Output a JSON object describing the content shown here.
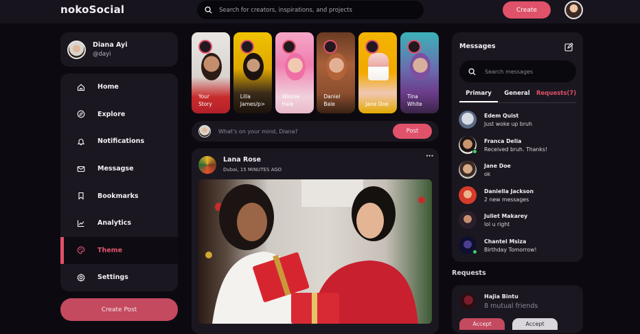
{
  "app": {
    "logo": "nokoSocial"
  },
  "topbar": {
    "search_placeholder": "Search for creators, inspirations, and projects",
    "create_label": "Create"
  },
  "profile": {
    "name": "Diana Ayi",
    "handle": "@dayi"
  },
  "sidebar": {
    "items": [
      {
        "label": "Home",
        "icon": "home-icon"
      },
      {
        "label": "Explore",
        "icon": "compass-icon"
      },
      {
        "label": "Notifications",
        "icon": "bell-icon"
      },
      {
        "label": "Messagse",
        "icon": "mail-icon"
      },
      {
        "label": "Bookmarks",
        "icon": "bookmark-icon"
      },
      {
        "label": "Analytics",
        "icon": "chart-icon"
      },
      {
        "label": "Theme",
        "icon": "palette-icon",
        "active": true
      },
      {
        "label": "Settings",
        "icon": "gear-icon"
      }
    ],
    "create_post_label": "Create Post"
  },
  "stories": [
    {
      "line1": "Your",
      "line2": "Story"
    },
    {
      "line1": "Lilla",
      "line2": "James/p>"
    },
    {
      "line1": "Winnie",
      "line2": "Hale"
    },
    {
      "line1": "Daniel",
      "line2": "Bale"
    },
    {
      "line1": "",
      "line2": "Jane Doe"
    },
    {
      "line1": "Tina",
      "line2": "White"
    }
  ],
  "composer": {
    "placeholder": "What's on your mind, Diana?",
    "post_label": "Post"
  },
  "feed": {
    "author": "Lana Rose",
    "location": "Dubai, 15 MINUTES AGO",
    "more": "···"
  },
  "messages": {
    "title": "Messages",
    "search_placeholder": "Search messages",
    "tabs": [
      "Primary",
      "General",
      "Requests(7)"
    ],
    "list": [
      {
        "name": "Edem Quist",
        "preview": "Just woke up bruh",
        "online": false
      },
      {
        "name": "Franca Delia",
        "preview": "Received bruh. Thanks!",
        "online": true
      },
      {
        "name": "Jane Doe",
        "preview": "ok",
        "online": false
      },
      {
        "name": "Daniella Jackson",
        "preview": "2 new messages",
        "online": false
      },
      {
        "name": "Juliet Makarey",
        "preview": "lol u right",
        "online": false
      },
      {
        "name": "Chantel Msiza",
        "preview": "Birthday Tomorrow!",
        "online": true
      }
    ]
  },
  "requests": {
    "title": "Requests",
    "name": "Hajia Bintu",
    "mutual": "8 mutual friends",
    "accept_label": "Accept",
    "decline_label": "Accept"
  },
  "colors": {
    "accent": "#e0516a",
    "background": "#0c0a10",
    "card": "#1a1720",
    "online": "#3dd26b"
  }
}
